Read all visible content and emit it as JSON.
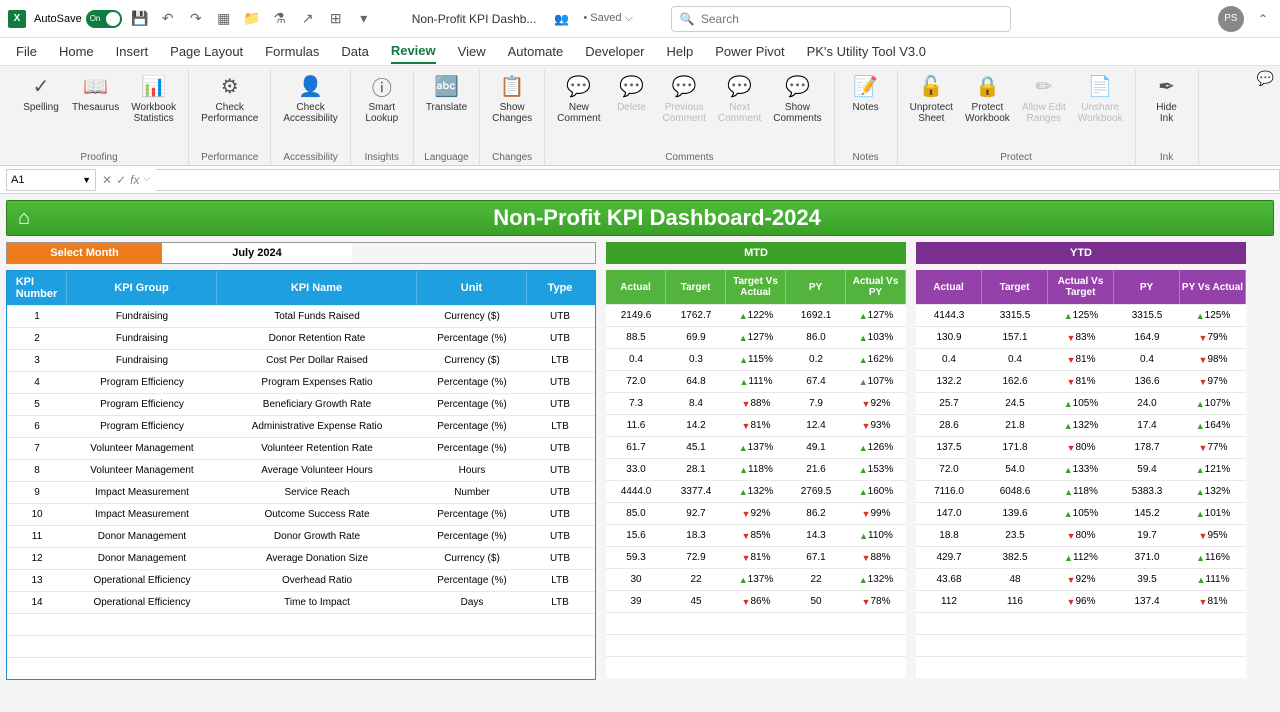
{
  "titlebar": {
    "autosave_label": "AutoSave",
    "autosave_on": "On",
    "doc_title": "Non-Profit KPI Dashb...",
    "saved": "Saved",
    "search_placeholder": "Search",
    "avatar": "PS"
  },
  "menu": [
    "File",
    "Home",
    "Insert",
    "Page Layout",
    "Formulas",
    "Data",
    "Review",
    "View",
    "Automate",
    "Developer",
    "Help",
    "Power Pivot",
    "PK's Utility Tool V3.0"
  ],
  "menu_active": "Review",
  "ribbon": [
    {
      "name": "Proofing",
      "items": [
        {
          "label": "Spelling",
          "icon": "✓"
        },
        {
          "label": "Thesaurus",
          "icon": "📖"
        },
        {
          "label": "Workbook\nStatistics",
          "icon": "📊"
        }
      ]
    },
    {
      "name": "Performance",
      "items": [
        {
          "label": "Check\nPerformance",
          "icon": "⚙"
        }
      ]
    },
    {
      "name": "Accessibility",
      "items": [
        {
          "label": "Check\nAccessibility",
          "icon": "👤"
        }
      ]
    },
    {
      "name": "Insights",
      "items": [
        {
          "label": "Smart\nLookup",
          "icon": "ⓘ"
        }
      ]
    },
    {
      "name": "Language",
      "items": [
        {
          "label": "Translate",
          "icon": "🔤"
        }
      ]
    },
    {
      "name": "Changes",
      "items": [
        {
          "label": "Show\nChanges",
          "icon": "📋"
        }
      ]
    },
    {
      "name": "Comments",
      "items": [
        {
          "label": "New\nComment",
          "icon": "💬"
        },
        {
          "label": "Delete",
          "icon": "💬",
          "disabled": true
        },
        {
          "label": "Previous\nComment",
          "icon": "💬",
          "disabled": true
        },
        {
          "label": "Next\nComment",
          "icon": "💬",
          "disabled": true
        },
        {
          "label": "Show\nComments",
          "icon": "💬"
        }
      ]
    },
    {
      "name": "Notes",
      "items": [
        {
          "label": "Notes",
          "icon": "📝"
        }
      ]
    },
    {
      "name": "Protect",
      "items": [
        {
          "label": "Unprotect\nSheet",
          "icon": "🔓"
        },
        {
          "label": "Protect\nWorkbook",
          "icon": "🔒"
        },
        {
          "label": "Allow Edit\nRanges",
          "icon": "✏",
          "disabled": true
        },
        {
          "label": "Unshare\nWorkbook",
          "icon": "📄",
          "disabled": true
        }
      ]
    },
    {
      "name": "Ink",
      "items": [
        {
          "label": "Hide\nInk",
          "icon": "✒"
        }
      ]
    }
  ],
  "name_box": "A1",
  "dashboard": {
    "title": "Non-Profit KPI Dashboard-2024",
    "select_month_label": "Select Month",
    "month": "July 2024",
    "mtd_label": "MTD",
    "ytd_label": "YTD",
    "left_headers": [
      "KPI\nNumber",
      "KPI Group",
      "KPI Name",
      "Unit",
      "Type"
    ],
    "mtd_headers": [
      "Actual",
      "Target",
      "Target Vs\nActual",
      "PY",
      "Actual Vs\nPY"
    ],
    "ytd_headers": [
      "Actual",
      "Target",
      "Actual Vs\nTarget",
      "PY",
      "PY Vs Actual"
    ],
    "rows": [
      {
        "num": "1",
        "grp": "Fundraising",
        "name": "Total Funds Raised",
        "unit": "Currency ($)",
        "type": "UTB",
        "mtd": [
          "2149.6",
          "1762.7",
          "122%",
          "1692.1",
          "127%"
        ],
        "mtd_dir": [
          "",
          "",
          "up",
          "",
          "up"
        ],
        "ytd": [
          "4144.3",
          "3315.5",
          "125%",
          "3315.5",
          "125%"
        ],
        "ytd_dir": [
          "",
          "",
          "up",
          "",
          "up"
        ]
      },
      {
        "num": "2",
        "grp": "Fundraising",
        "name": "Donor Retention Rate",
        "unit": "Percentage (%)",
        "type": "UTB",
        "mtd": [
          "88.5",
          "69.9",
          "127%",
          "86.0",
          "103%"
        ],
        "mtd_dir": [
          "",
          "",
          "up",
          "",
          "up"
        ],
        "ytd": [
          "130.9",
          "157.1",
          "83%",
          "164.9",
          "79%"
        ],
        "ytd_dir": [
          "",
          "",
          "dn",
          "",
          "dn"
        ]
      },
      {
        "num": "3",
        "grp": "Fundraising",
        "name": "Cost Per Dollar Raised",
        "unit": "Currency ($)",
        "type": "LTB",
        "mtd": [
          "0.4",
          "0.3",
          "115%",
          "0.2",
          "162%"
        ],
        "mtd_dir": [
          "",
          "",
          "up",
          "",
          "up"
        ],
        "ytd": [
          "0.4",
          "0.4",
          "81%",
          "0.4",
          "98%"
        ],
        "ytd_dir": [
          "",
          "",
          "dn",
          "",
          "dn"
        ]
      },
      {
        "num": "4",
        "grp": "Program Efficiency",
        "name": "Program Expenses Ratio",
        "unit": "Percentage (%)",
        "type": "UTB",
        "mtd": [
          "72.0",
          "64.8",
          "111%",
          "67.4",
          "107%"
        ],
        "mtd_dir": [
          "",
          "",
          "up",
          "",
          "up"
        ],
        "ytd": [
          "132.2",
          "162.6",
          "81%",
          "136.6",
          "97%"
        ],
        "ytd_dir": [
          "",
          "",
          "dn",
          "",
          "dn"
        ]
      },
      {
        "num": "5",
        "grp": "Program Efficiency",
        "name": "Beneficiary Growth Rate",
        "unit": "Percentage (%)",
        "type": "UTB",
        "mtd": [
          "7.3",
          "8.4",
          "88%",
          "7.9",
          "92%"
        ],
        "mtd_dir": [
          "",
          "",
          "dn",
          "",
          "dn"
        ],
        "ytd": [
          "25.7",
          "24.5",
          "105%",
          "24.0",
          "107%"
        ],
        "ytd_dir": [
          "",
          "",
          "up",
          "",
          "up"
        ]
      },
      {
        "num": "6",
        "grp": "Program Efficiency",
        "name": "Administrative Expense Ratio",
        "unit": "Percentage (%)",
        "type": "LTB",
        "mtd": [
          "11.6",
          "14.2",
          "81%",
          "12.4",
          "93%"
        ],
        "mtd_dir": [
          "",
          "",
          "dn",
          "",
          "dn"
        ],
        "ytd": [
          "28.6",
          "21.8",
          "132%",
          "17.4",
          "164%"
        ],
        "ytd_dir": [
          "",
          "",
          "up",
          "",
          "up"
        ]
      },
      {
        "num": "7",
        "grp": "Volunteer Management",
        "name": "Volunteer Retention Rate",
        "unit": "Percentage (%)",
        "type": "UTB",
        "mtd": [
          "61.7",
          "45.1",
          "137%",
          "49.1",
          "126%"
        ],
        "mtd_dir": [
          "",
          "",
          "up",
          "",
          "up"
        ],
        "ytd": [
          "137.5",
          "171.8",
          "80%",
          "178.7",
          "77%"
        ],
        "ytd_dir": [
          "",
          "",
          "dn",
          "",
          "dn"
        ]
      },
      {
        "num": "8",
        "grp": "Volunteer Management",
        "name": "Average Volunteer Hours",
        "unit": "Hours",
        "type": "UTB",
        "mtd": [
          "33.0",
          "28.1",
          "118%",
          "21.6",
          "153%"
        ],
        "mtd_dir": [
          "",
          "",
          "up",
          "",
          "up"
        ],
        "ytd": [
          "72.0",
          "54.0",
          "133%",
          "59.4",
          "121%"
        ],
        "ytd_dir": [
          "",
          "",
          "up",
          "",
          "up"
        ]
      },
      {
        "num": "9",
        "grp": "Impact Measurement",
        "name": "Service Reach",
        "unit": "Number",
        "type": "UTB",
        "mtd": [
          "4444.0",
          "3377.4",
          "132%",
          "2769.5",
          "160%"
        ],
        "mtd_dir": [
          "",
          "",
          "up",
          "",
          "up"
        ],
        "ytd": [
          "7116.0",
          "6048.6",
          "118%",
          "5383.3",
          "132%"
        ],
        "ytd_dir": [
          "",
          "",
          "up",
          "",
          "up"
        ]
      },
      {
        "num": "10",
        "grp": "Impact Measurement",
        "name": "Outcome Success Rate",
        "unit": "Percentage (%)",
        "type": "UTB",
        "mtd": [
          "85.0",
          "92.7",
          "92%",
          "86.2",
          "99%"
        ],
        "mtd_dir": [
          "",
          "",
          "dn",
          "",
          "dn"
        ],
        "ytd": [
          "147.0",
          "139.6",
          "105%",
          "145.2",
          "101%"
        ],
        "ytd_dir": [
          "",
          "",
          "up",
          "",
          "up"
        ]
      },
      {
        "num": "11",
        "grp": "Donor Management",
        "name": "Donor Growth Rate",
        "unit": "Percentage (%)",
        "type": "UTB",
        "mtd": [
          "15.6",
          "18.3",
          "85%",
          "14.3",
          "110%"
        ],
        "mtd_dir": [
          "",
          "",
          "dn",
          "",
          "up"
        ],
        "ytd": [
          "18.8",
          "23.5",
          "80%",
          "19.7",
          "95%"
        ],
        "ytd_dir": [
          "",
          "",
          "dn",
          "",
          "dn"
        ]
      },
      {
        "num": "12",
        "grp": "Donor Management",
        "name": "Average Donation Size",
        "unit": "Currency ($)",
        "type": "UTB",
        "mtd": [
          "59.3",
          "72.9",
          "81%",
          "67.1",
          "88%"
        ],
        "mtd_dir": [
          "",
          "",
          "dn",
          "",
          "dn"
        ],
        "ytd": [
          "429.7",
          "382.5",
          "112%",
          "371.0",
          "116%"
        ],
        "ytd_dir": [
          "",
          "",
          "up",
          "",
          "up"
        ]
      },
      {
        "num": "13",
        "grp": "Operational Efficiency",
        "name": "Overhead Ratio",
        "unit": "Percentage (%)",
        "type": "LTB",
        "mtd": [
          "30",
          "22",
          "137%",
          "22",
          "132%"
        ],
        "mtd_dir": [
          "",
          "",
          "up",
          "",
          "up"
        ],
        "ytd": [
          "43.68",
          "48",
          "92%",
          "39.5",
          "111%"
        ],
        "ytd_dir": [
          "",
          "",
          "dn",
          "",
          "up"
        ]
      },
      {
        "num": "14",
        "grp": "Operational Efficiency",
        "name": "Time to Impact",
        "unit": "Days",
        "type": "LTB",
        "mtd": [
          "39",
          "45",
          "86%",
          "50",
          "78%"
        ],
        "mtd_dir": [
          "",
          "",
          "dn",
          "",
          "dn"
        ],
        "ytd": [
          "112",
          "116",
          "96%",
          "137.4",
          "81%"
        ],
        "ytd_dir": [
          "",
          "",
          "dn",
          "",
          "dn"
        ]
      }
    ]
  }
}
